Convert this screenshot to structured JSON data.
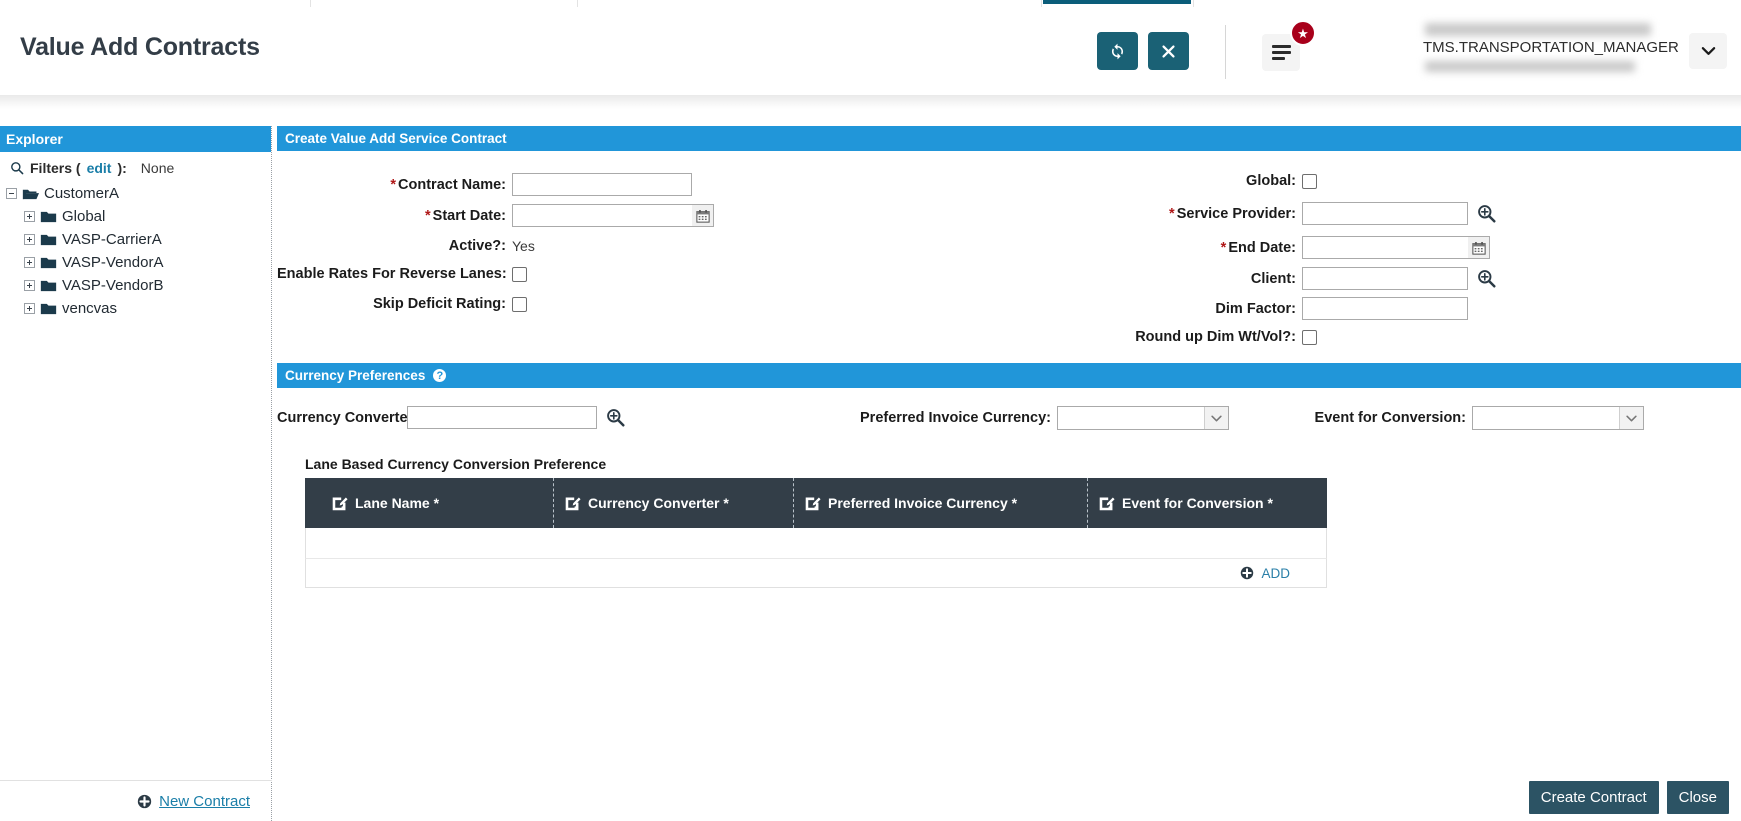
{
  "header": {
    "title": "Value Add Contracts",
    "refresh_icon": "refresh-icon",
    "close_icon": "close-x-icon",
    "menu_icon": "hamburger-menu-icon",
    "badge_icon": "star-badge-icon",
    "user_name": "TMS.TRANSPORTATION_MANAGER",
    "user_caret_icon": "chevron-down-icon"
  },
  "explorer": {
    "title": "Explorer",
    "search_icon": "search-icon",
    "filters_label": "Filters (",
    "filters_edit": "edit",
    "filters_label_end": "):",
    "filters_value": "None",
    "root": {
      "label": "CustomerA",
      "toggle": "collapse-toggle"
    },
    "nodes": [
      {
        "label": "Global"
      },
      {
        "label": "VASP-CarrierA"
      },
      {
        "label": "VASP-VendorA"
      },
      {
        "label": "VASP-VendorB"
      },
      {
        "label": "vencvas"
      }
    ],
    "new_contract_label": "New Contract",
    "new_contract_icon": "plus-circle-icon"
  },
  "contract_section": {
    "title": "Create Value Add Service Contract",
    "fields": {
      "contract_name_label": "Contract Name:",
      "contract_name_value": "",
      "start_date_label": "Start Date:",
      "start_date_value": "",
      "active_label": "Active?:",
      "active_value": "Yes",
      "reverse_lanes_label": "Enable Rates For Reverse Lanes:",
      "skip_deficit_label": "Skip Deficit Rating:",
      "global_label": "Global:",
      "service_provider_label": "Service Provider:",
      "service_provider_value": "",
      "end_date_label": "End Date:",
      "end_date_value": "",
      "client_label": "Client:",
      "client_value": "",
      "dim_factor_label": "Dim Factor:",
      "dim_factor_value": "",
      "round_up_label": "Round up Dim Wt/Vol?:"
    },
    "icons": {
      "calendar": "calendar-icon",
      "magnifier": "search-magnifier-icon"
    }
  },
  "currency_section": {
    "title": "Currency Preferences",
    "help_icon": "help-icon",
    "converter_label": "Currency Converter:",
    "converter_value": "",
    "preferred_currency_label": "Preferred Invoice Currency:",
    "preferred_currency_value": "",
    "event_conversion_label": "Event for Conversion:",
    "event_conversion_value": "",
    "lane_title": "Lane Based Currency Conversion Preference",
    "table": {
      "columns": [
        {
          "label": "Lane Name *",
          "icon": "edit-required-icon"
        },
        {
          "label": "Currency Converter *",
          "icon": "edit-required-icon"
        },
        {
          "label": "Preferred Invoice Currency *",
          "icon": "edit-required-icon"
        },
        {
          "label": "Event for Conversion *",
          "icon": "edit-required-icon"
        }
      ],
      "rows": [],
      "add_label": "ADD",
      "add_icon": "plus-circle-icon"
    }
  },
  "footer": {
    "create_label": "Create Contract",
    "close_label": "Close"
  },
  "colors": {
    "accent_blue": "#2196d9",
    "teal_button": "#1a6175",
    "dark_header": "#333e48",
    "footer_button": "#2c5364",
    "link": "#1a7ea8",
    "required_red": "#b01818",
    "badge_red": "#a8001b"
  }
}
